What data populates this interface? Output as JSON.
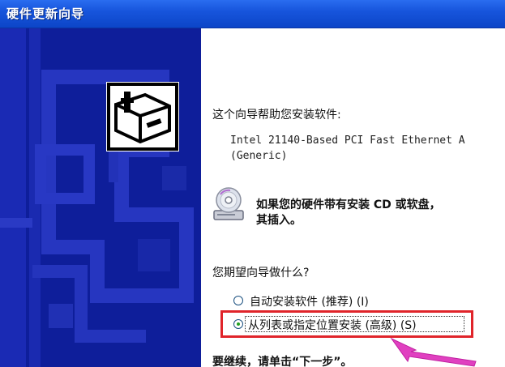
{
  "window": {
    "title": "硬件更新向导"
  },
  "content": {
    "intro": "这个向导帮助您安装软件:",
    "device_line1": "Intel 21140-Based PCI Fast Ethernet A",
    "device_line2": "(Generic)",
    "cd_text_line1": "如果您的硬件带有安装 CD 或软盘，",
    "cd_text_line2": "其插入。",
    "question": "您期望向导做什么?",
    "options": [
      {
        "label": "自动安装软件 (推荐) (I)",
        "selected": false
      },
      {
        "label": "从列表或指定位置安装 (高级) (S)",
        "selected": true
      }
    ],
    "continue_hint": "要继续，请单击“下一步”。"
  },
  "icons": {
    "wizard": "hardware-wizard-icon",
    "cd": "cd-drive-icon",
    "arrow": "pointer-arrow-icon"
  },
  "colors": {
    "title_bar": "#1755dc",
    "left_panel": "#0e1e9a",
    "highlight": "#e0242a",
    "arrow": "#e040c0",
    "radio_dot": "#21a121"
  }
}
